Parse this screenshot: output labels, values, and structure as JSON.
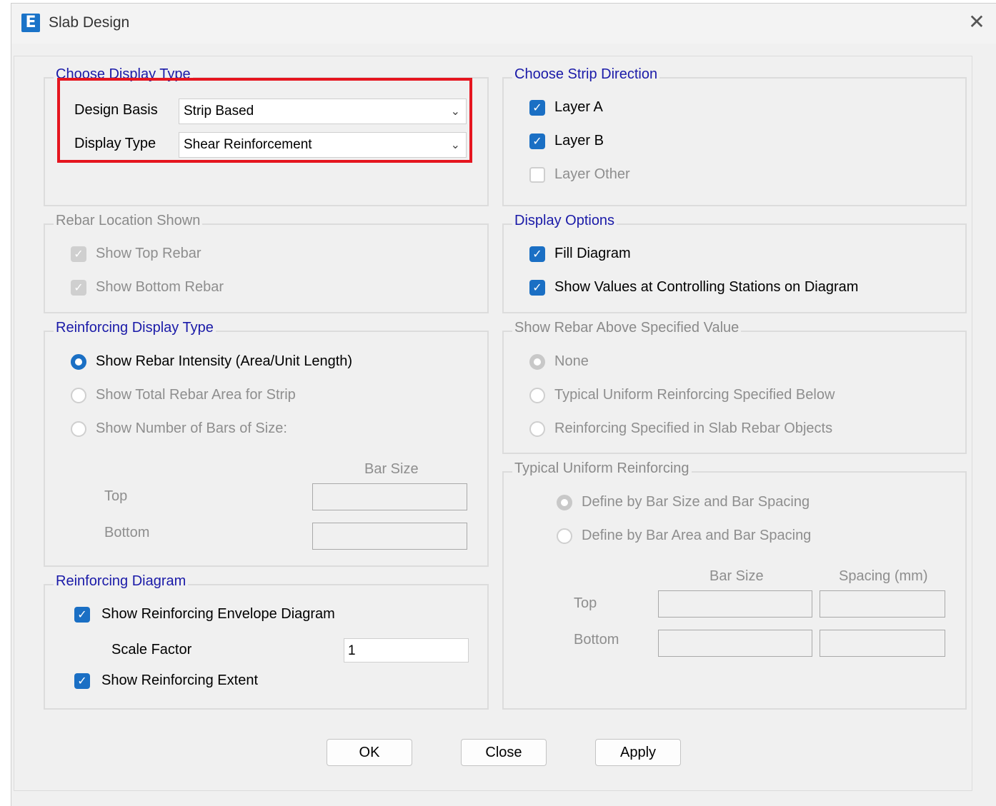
{
  "window": {
    "title": "Slab Design",
    "app_icon_letter": "E",
    "close_glyph": "✕"
  },
  "display_type_group": {
    "legend": "Choose Display Type",
    "design_basis_label": "Design Basis",
    "design_basis_value": "Strip Based",
    "display_type_label": "Display Type",
    "display_type_value": "Shear Reinforcement"
  },
  "strip_direction_group": {
    "legend": "Choose Strip Direction",
    "layer_a": "Layer A",
    "layer_b": "Layer B",
    "layer_other": "Layer Other"
  },
  "rebar_location_group": {
    "legend": "Rebar Location Shown",
    "show_top": "Show Top Rebar",
    "show_bottom": "Show Bottom Rebar"
  },
  "display_options_group": {
    "legend": "Display Options",
    "fill_diagram": "Fill Diagram",
    "show_values": "Show Values at Controlling Stations on Diagram"
  },
  "reinforcing_display_group": {
    "legend": "Reinforcing Display Type",
    "opt_intensity": "Show Rebar Intensity (Area/Unit Length)",
    "opt_total": "Show Total Rebar Area for Strip",
    "opt_number": "Show Number of Bars of Size:",
    "bar_size_header": "Bar Size",
    "top_label": "Top",
    "bottom_label": "Bottom"
  },
  "show_rebar_above_group": {
    "legend": "Show Rebar Above Specified Value",
    "opt_none": "None",
    "opt_typical": "Typical Uniform Reinforcing Specified Below",
    "opt_slab_objects": "Reinforcing Specified in Slab Rebar Objects"
  },
  "typical_uniform_group": {
    "legend": "Typical Uniform Reinforcing",
    "opt_bar_size": "Define by Bar Size and Bar Spacing",
    "opt_bar_area": "Define by Bar Area and Bar Spacing",
    "bar_size_header": "Bar Size",
    "spacing_header": "Spacing  (mm)",
    "top_label": "Top",
    "bottom_label": "Bottom"
  },
  "reinforcing_diagram_group": {
    "legend": "Reinforcing Diagram",
    "show_envelope": "Show Reinforcing Envelope Diagram",
    "scale_factor_label": "Scale Factor",
    "scale_factor_value": "1",
    "show_extent": "Show Reinforcing Extent"
  },
  "buttons": {
    "ok": "OK",
    "close": "Close",
    "apply": "Apply"
  }
}
